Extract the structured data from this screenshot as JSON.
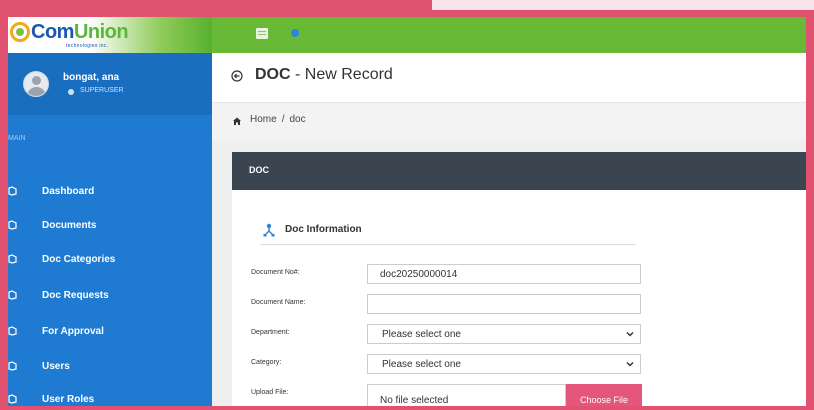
{
  "brand": {
    "logo_com": "Com",
    "logo_union": "Union",
    "logo_sub": "technologies inc."
  },
  "user": {
    "name": "bongat, ana",
    "role": "SUPERUSER"
  },
  "sidebar": {
    "section": "MAIN",
    "items": [
      {
        "label": "Dashboard"
      },
      {
        "label": "Documents"
      },
      {
        "label": "Doc Categories"
      },
      {
        "label": "Doc Requests"
      },
      {
        "label": "For Approval"
      },
      {
        "label": "Users"
      },
      {
        "label": "User Roles"
      }
    ]
  },
  "header": {
    "title_strong": "DOC",
    "title_rest": " - New Record"
  },
  "breadcrumb": {
    "home": "Home",
    "separator": "/",
    "current": "doc"
  },
  "card": {
    "title": "DOC",
    "section_title": "Doc Information"
  },
  "form": {
    "document_no_label": "Document No#:",
    "document_no_value": "doc20250000014",
    "document_name_label": "Document Name:",
    "document_name_value": "",
    "department_label": "Department:",
    "department_value": "Please select one",
    "category_label": "Category:",
    "category_value": "Please select one",
    "upload_label": "Upload File:",
    "upload_value": "No file selected",
    "choose_file": "Choose File"
  },
  "colors": {
    "sidebar": "#1f7bd1",
    "topbar": "#68b936",
    "card_header": "#3b4550",
    "accent": "#e4567a",
    "border": "#e0526f"
  }
}
